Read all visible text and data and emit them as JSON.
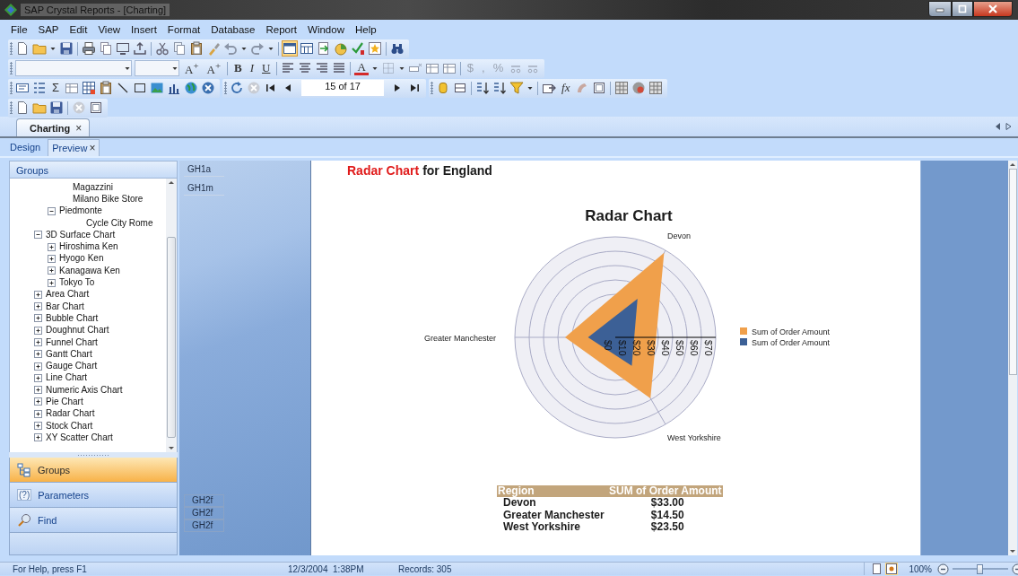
{
  "window": {
    "title": "SAP Crystal Reports - [Charting]"
  },
  "menu": [
    {
      "label": "File"
    },
    {
      "label": "SAP"
    },
    {
      "label": "Edit"
    },
    {
      "label": "View"
    },
    {
      "label": "Insert"
    },
    {
      "label": "Format"
    },
    {
      "label": "Database"
    },
    {
      "label": "Report"
    },
    {
      "label": "Window"
    },
    {
      "label": "Help"
    }
  ],
  "toolbars": [
    {
      "items": [
        {
          "kind": "toggle",
          "on": true
        },
        {
          "kind": "toggle",
          "on": false
        }
      ]
    },
    {
      "items": [
        {
          "kind": "text",
          "label": "A$^{+}$",
          "disabled": false
        },
        {
          "kind": "text",
          "label": "A$^{+}$",
          "disabled": false
        },
        {
          "kind": "text",
          "label": "B",
          "disabled": false
        },
        {
          "kind": "text",
          "label": "I",
          "disabled": false
        },
        {
          "kind": "text",
          "label": "U",
          "disabled": false
        },
        {
          "kind": "text",
          "label": "A",
          "disabled": false
        },
        {
          "kind": "text",
          "label": "$",
          "disabled": true
        },
        {
          "kind": "text",
          "label": ",",
          "disabled": true
        },
        {
          "kind": "text",
          "label": "%",
          "disabled": true
        }
      ]
    },
    {
      "items": [
        {
          "kind": "text",
          "label": "Σ",
          "disabled": false
        },
        {
          "kind": "field",
          "value": "15 of 17"
        },
        {
          "kind": "text",
          "label": "fx",
          "disabled": false
        }
      ]
    }
  ],
  "document_tabs": [
    {
      "label": "Charting",
      "close": "×",
      "selected": true
    }
  ],
  "view_tabs": [
    {
      "label": "Design",
      "selected": false
    },
    {
      "label": "Preview",
      "close": "×",
      "selected": true
    }
  ],
  "groups_panel": {
    "title": "Groups",
    "tree": [
      {
        "children": [
          {
            "label": "Magazzini"
          },
          {
            "label": "Milano Bike Store"
          },
          {
            "label": "Piedmonte",
            "expanded": true,
            "children": [
              {
                "label": "Cycle City Rome"
              }
            ]
          }
        ]
      },
      {
        "label": "3D Surface Chart",
        "expanded": true,
        "children": [
          {
            "label": "Hiroshima Ken",
            "expanded": false
          },
          {
            "label": "Hyogo Ken",
            "expanded": false
          },
          {
            "label": "Kanagawa Ken",
            "expanded": false
          },
          {
            "label": "Tokyo To",
            "expanded": false
          }
        ]
      },
      {
        "label": "Area Chart",
        "expanded": false
      },
      {
        "label": "Bar Chart",
        "expanded": false
      },
      {
        "label": "Bubble Chart",
        "expanded": false
      },
      {
        "label": "Doughnut Chart",
        "expanded": false
      },
      {
        "label": "Funnel Chart",
        "expanded": false
      },
      {
        "label": "Gantt Chart",
        "expanded": false
      },
      {
        "label": "Gauge Chart",
        "expanded": false
      },
      {
        "label": "Line Chart",
        "expanded": false
      },
      {
        "label": "Numeric Axis Chart",
        "expanded": false
      },
      {
        "label": "Pie Chart",
        "expanded": false
      },
      {
        "label": "Radar Chart",
        "expanded": false
      },
      {
        "label": "Stock Chart",
        "expanded": false
      },
      {
        "label": "XY Scatter Chart",
        "expanded": false
      }
    ],
    "nav": [
      {
        "kind": "groups",
        "label": "Groups",
        "selected": true
      },
      {
        "kind": "parameters",
        "glyph": "(?)",
        "label": "Parameters",
        "selected": false
      },
      {
        "kind": "find",
        "label": "Find",
        "selected": false
      }
    ]
  },
  "section_labels": {
    "top": [
      "GH1a",
      "GH1m"
    ],
    "bottom": [
      "GH2f",
      "GH2f",
      "GH2f"
    ]
  },
  "report": {
    "title_highlight": "Radar Chart",
    "title_rest": "for England",
    "chart_data": {
      "type": "radar",
      "title": "Radar Chart",
      "categories": [
        "Devon",
        "West Yorkshire",
        "Greater Manchester"
      ],
      "series": [
        {
          "name": "Sum of Order Amount",
          "color": "#f0a04b",
          "values": [
            68,
            49,
            35
          ]
        },
        {
          "name": "Sum of Order Amount",
          "color": "#3c6096",
          "values": [
            31,
            23,
            19
          ]
        }
      ],
      "ylim": [
        0,
        70
      ],
      "yticks": [
        {
          "value": 0,
          "label": "$0"
        },
        {
          "value": 10,
          "label": "$10"
        },
        {
          "value": 20,
          "label": "$20"
        },
        {
          "value": 30,
          "label": "$30"
        },
        {
          "value": 40,
          "label": "$40"
        },
        {
          "value": 50,
          "label": "$50"
        },
        {
          "value": 60,
          "label": "$60"
        },
        {
          "value": 70,
          "label": "$70"
        }
      ]
    },
    "table": {
      "columns": [
        "Region",
        "SUM of Order Amount"
      ],
      "rows": [
        [
          "Devon",
          "$33.00"
        ],
        [
          "Greater Manchester",
          "$14.50"
        ],
        [
          "West Yorkshire",
          "$23.50"
        ]
      ]
    }
  },
  "status_bar": {
    "help": "For Help, press F1",
    "datetime": "12/3/2004  1:38PM",
    "records": "Records: 305",
    "views": [
      {
        "selected": false
      },
      {
        "selected": true
      }
    ],
    "zoom": "100%",
    "zoom_slider": {
      "level": 0.5
    }
  }
}
